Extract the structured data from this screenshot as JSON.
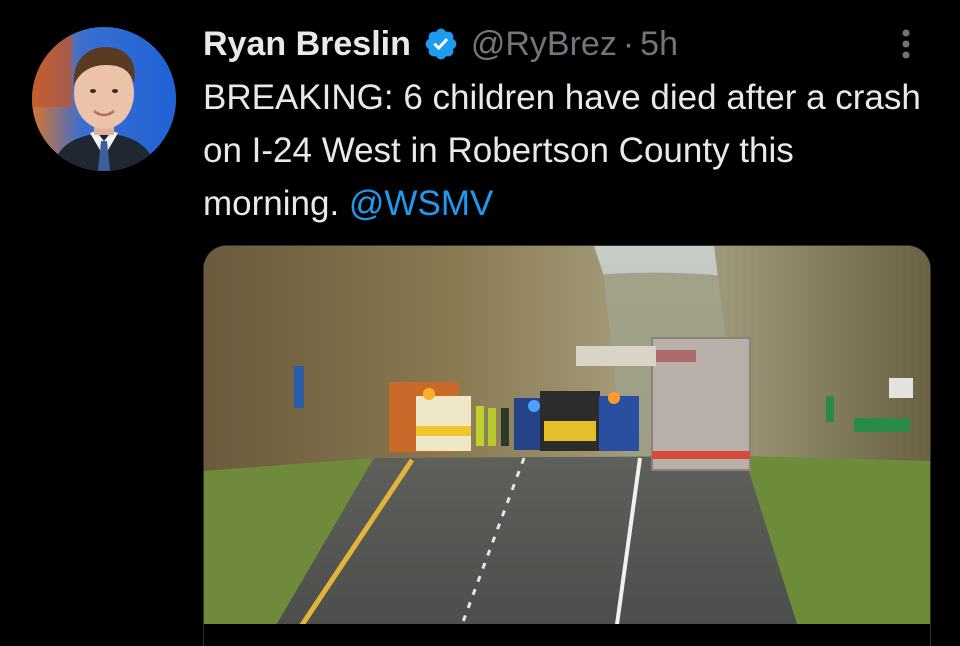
{
  "tweet": {
    "display_name": "Ryan Breslin",
    "handle": "@RyBrez",
    "separator": "·",
    "time": "5h",
    "text_part1": "BREAKING: 6 children have died after a crash on I-24 West in Robertson County this morning. ",
    "mention": "@WSMV",
    "verified": true
  },
  "colors": {
    "background": "#000000",
    "primary_text": "#e7e9ea",
    "secondary_text": "#71767b",
    "link": "#1d9bf0",
    "verified_badge": "#1d9bf0"
  },
  "icons": {
    "verified": "verified-badge-icon",
    "more": "more-vertical-icon"
  }
}
